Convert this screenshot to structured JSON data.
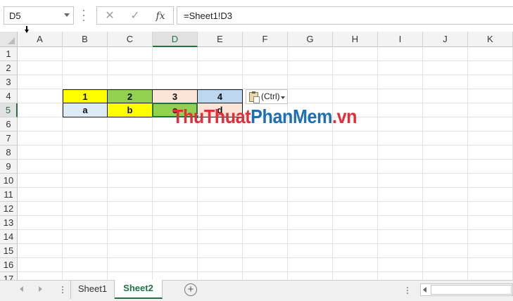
{
  "formula_bar": {
    "name_box": "D5",
    "fx_label": "fx",
    "cancel_icon": "✕",
    "enter_icon": "✓",
    "formula": "=Sheet1!D3"
  },
  "columns": [
    "A",
    "B",
    "C",
    "D",
    "E",
    "F",
    "G",
    "H",
    "I",
    "J",
    "K"
  ],
  "active_column": "D",
  "rows": [
    "1",
    "2",
    "3",
    "4",
    "5",
    "6",
    "7",
    "8",
    "9",
    "10",
    "11",
    "12",
    "13",
    "14",
    "15",
    "16",
    "17"
  ],
  "active_row": "5",
  "cells": {
    "B4": {
      "value": "1",
      "fill": "#ffff00"
    },
    "C4": {
      "value": "2",
      "fill": "#92d050"
    },
    "D4": {
      "value": "3",
      "fill": "#fce4d6"
    },
    "E4": {
      "value": "4",
      "fill": "#bdd7ee"
    },
    "B5": {
      "value": "a",
      "fill": "#ddebf7"
    },
    "C5": {
      "value": "b",
      "fill": "#ffff00"
    },
    "D5": {
      "value": "c",
      "fill": "#92d050"
    },
    "E5": {
      "value": "d",
      "fill": "#fce4d6"
    }
  },
  "paste_options": {
    "label": "(Ctrl)",
    "icon": "clipboard-icon"
  },
  "watermark": {
    "part1": "ThuThuat",
    "part2": "PhanMem",
    "part3": ".vn"
  },
  "sheet_tabs": [
    {
      "label": "Sheet1",
      "active": false
    },
    {
      "label": "Sheet2",
      "active": true
    }
  ],
  "colors": {
    "accent": "#217346"
  }
}
